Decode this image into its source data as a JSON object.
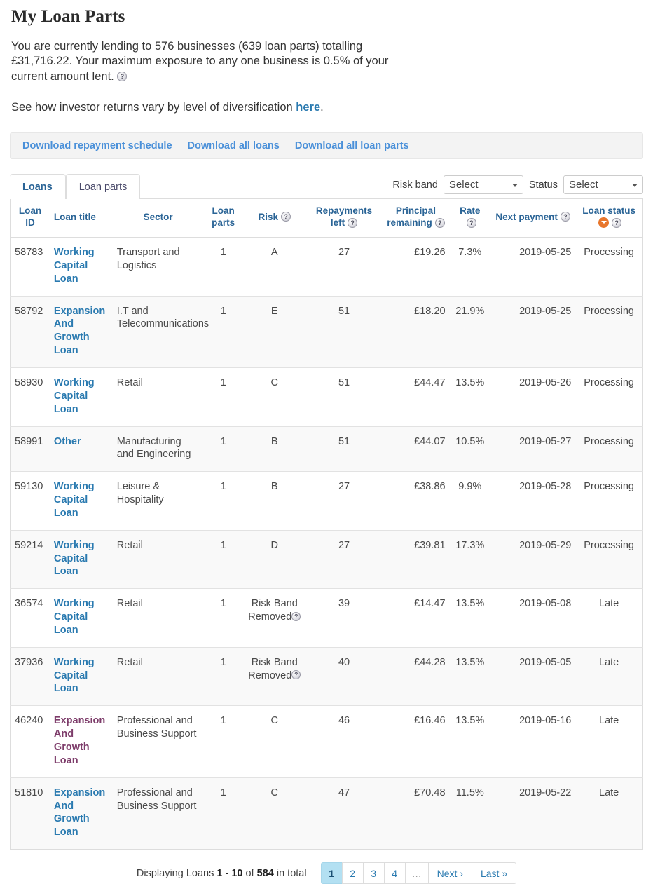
{
  "page": {
    "title": "My Loan Parts",
    "intro_line1": "You are currently lending to 576 businesses (639 loan parts) totalling",
    "intro_line2": "£31,716.22. Your maximum exposure to any one business is 0.5% of your",
    "intro_line3": "current amount lent.",
    "intro_help": "?",
    "diversification_prefix": "See how investor returns vary by level of diversification ",
    "diversification_link": "here",
    "diversification_suffix": "."
  },
  "downloads": {
    "repayment_schedule": "Download repayment schedule",
    "all_loans": "Download all loans",
    "all_loan_parts": "Download all loan parts"
  },
  "tabs": [
    {
      "label": "Loans",
      "active": true
    },
    {
      "label": "Loan parts",
      "active": false
    }
  ],
  "filters": {
    "risk_band_label": "Risk band",
    "risk_band_value": "Select",
    "status_label": "Status",
    "status_value": "Select",
    "options": [
      "Select"
    ]
  },
  "table": {
    "headers": {
      "loan_id": "Loan ID",
      "loan_title": "Loan title",
      "sector": "Sector",
      "loan_parts": "Loan parts",
      "risk": "Risk",
      "repayments_left": "Repayments left",
      "principal_remaining": "Principal remaining",
      "rate": "Rate",
      "next_payment": "Next payment",
      "loan_status": "Loan status"
    },
    "help_glyph": "?",
    "sorted_column": "loan_status",
    "sort_direction": "desc",
    "rows": [
      {
        "loan_id": "58783",
        "loan_title": "Working Capital Loan",
        "title_visited": false,
        "sector": "Transport and Logistics",
        "loan_parts": "1",
        "risk": "A",
        "risk_removed": false,
        "repayments_left": "27",
        "principal_remaining": "£19.26",
        "rate": "7.3%",
        "next_payment": "2019-05-25",
        "loan_status": "Processing"
      },
      {
        "loan_id": "58792",
        "loan_title": "Expansion And Growth Loan",
        "title_visited": false,
        "sector": "I.T and Telecommunications",
        "loan_parts": "1",
        "risk": "E",
        "risk_removed": false,
        "repayments_left": "51",
        "principal_remaining": "£18.20",
        "rate": "21.9%",
        "next_payment": "2019-05-25",
        "loan_status": "Processing"
      },
      {
        "loan_id": "58930",
        "loan_title": "Working Capital Loan",
        "title_visited": false,
        "sector": "Retail",
        "loan_parts": "1",
        "risk": "C",
        "risk_removed": false,
        "repayments_left": "51",
        "principal_remaining": "£44.47",
        "rate": "13.5%",
        "next_payment": "2019-05-26",
        "loan_status": "Processing"
      },
      {
        "loan_id": "58991",
        "loan_title": "Other",
        "title_visited": false,
        "sector": "Manufacturing and Engineering",
        "loan_parts": "1",
        "risk": "B",
        "risk_removed": false,
        "repayments_left": "51",
        "principal_remaining": "£44.07",
        "rate": "10.5%",
        "next_payment": "2019-05-27",
        "loan_status": "Processing"
      },
      {
        "loan_id": "59130",
        "loan_title": "Working Capital Loan",
        "title_visited": false,
        "sector": "Leisure & Hospitality",
        "loan_parts": "1",
        "risk": "B",
        "risk_removed": false,
        "repayments_left": "27",
        "principal_remaining": "£38.86",
        "rate": "9.9%",
        "next_payment": "2019-05-28",
        "loan_status": "Processing"
      },
      {
        "loan_id": "59214",
        "loan_title": "Working Capital Loan",
        "title_visited": false,
        "sector": "Retail",
        "loan_parts": "1",
        "risk": "D",
        "risk_removed": false,
        "repayments_left": "27",
        "principal_remaining": "£39.81",
        "rate": "17.3%",
        "next_payment": "2019-05-29",
        "loan_status": "Processing"
      },
      {
        "loan_id": "36574",
        "loan_title": "Working Capital Loan",
        "title_visited": false,
        "sector": "Retail",
        "loan_parts": "1",
        "risk": "Risk Band Removed",
        "risk_removed": true,
        "repayments_left": "39",
        "principal_remaining": "£14.47",
        "rate": "13.5%",
        "next_payment": "2019-05-08",
        "loan_status": "Late"
      },
      {
        "loan_id": "37936",
        "loan_title": "Working Capital Loan",
        "title_visited": false,
        "sector": "Retail",
        "loan_parts": "1",
        "risk": "Risk Band Removed",
        "risk_removed": true,
        "repayments_left": "40",
        "principal_remaining": "£44.28",
        "rate": "13.5%",
        "next_payment": "2019-05-05",
        "loan_status": "Late"
      },
      {
        "loan_id": "46240",
        "loan_title": "Expansion And Growth Loan",
        "title_visited": true,
        "sector": "Professional and Business Support",
        "loan_parts": "1",
        "risk": "C",
        "risk_removed": false,
        "repayments_left": "46",
        "principal_remaining": "£16.46",
        "rate": "13.5%",
        "next_payment": "2019-05-16",
        "loan_status": "Late"
      },
      {
        "loan_id": "51810",
        "loan_title": "Expansion And Growth Loan",
        "title_visited": false,
        "sector": "Professional and Business Support",
        "loan_parts": "1",
        "risk": "C",
        "risk_removed": false,
        "repayments_left": "47",
        "principal_remaining": "£70.48",
        "rate": "11.5%",
        "next_payment": "2019-05-22",
        "loan_status": "Late"
      }
    ]
  },
  "pagination": {
    "summary_prefix": "Displaying Loans ",
    "summary_range": "1 - 10",
    "summary_mid": " of ",
    "summary_total": "584",
    "summary_suffix": " in total",
    "pages": [
      {
        "label": "1",
        "active": true
      },
      {
        "label": "2",
        "active": false
      },
      {
        "label": "3",
        "active": false
      },
      {
        "label": "4",
        "active": false
      },
      {
        "label": "…",
        "active": false
      },
      {
        "label": "Next ›",
        "active": false
      },
      {
        "label": "Last »",
        "active": false
      }
    ]
  },
  "colors": {
    "link": "#2a7ab0",
    "link_visited": "#7d3c6a",
    "download_link": "#4a90d9",
    "sort_accent": "#e8762c",
    "pager_active_bg": "#b3e0f2"
  }
}
